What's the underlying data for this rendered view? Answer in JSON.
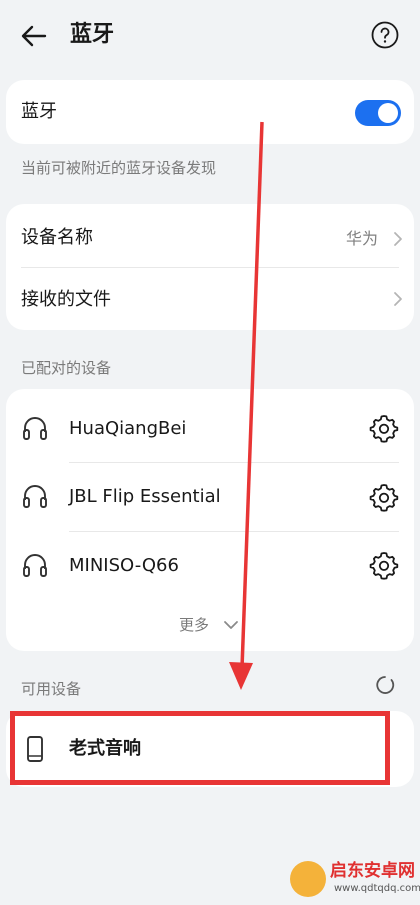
{
  "header": {
    "title": "蓝牙",
    "back_icon": "arrow-left-icon",
    "help_icon": "help-circle-icon"
  },
  "bluetooth": {
    "label": "蓝牙",
    "enabled": true,
    "accent": "#1c70f0"
  },
  "discover_note": "当前可被附近的蓝牙设备发现",
  "settings": {
    "device_name_label": "设备名称",
    "device_name_value": "华为",
    "received_files_label": "接收的文件"
  },
  "paired": {
    "section_label": "已配对的设备",
    "devices": [
      {
        "name": "HuaQiangBei",
        "icon": "headphones-icon"
      },
      {
        "name": "JBL Flip Essential",
        "icon": "headphones-icon"
      },
      {
        "name": "MINISO-Q66",
        "icon": "headphones-icon"
      }
    ],
    "more_label": "更多"
  },
  "available": {
    "section_label": "可用设备",
    "devices": [
      {
        "name": "老式音响",
        "icon": "phone-icon"
      }
    ]
  },
  "annotation": {
    "color": "#e83535"
  },
  "watermark": {
    "text": "启东安卓网",
    "sub": "www.qdtqdq.com"
  }
}
